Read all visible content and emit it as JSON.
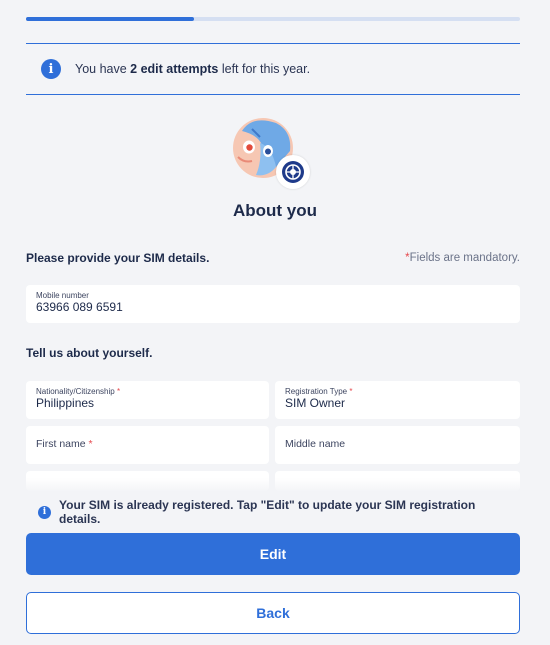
{
  "progress": {
    "fraction": 0.34
  },
  "notice": {
    "prefix": "You have ",
    "strong": "2 edit attempts",
    "suffix": " left for this year."
  },
  "page": {
    "title": "About you"
  },
  "sim_section": {
    "label": "Please provide your SIM details.",
    "mandatory_asterisk": "*",
    "mandatory_text": "Fields are mandatory."
  },
  "mobile": {
    "label": "Mobile number",
    "value": "63966 089 6591"
  },
  "about_section": {
    "label": "Tell us about yourself."
  },
  "fields": {
    "nationality": {
      "label": "Nationality/Citizenship",
      "required": "*",
      "value": "Philippines"
    },
    "registration_type": {
      "label": "Registration Type",
      "required": "*",
      "value": "SIM Owner"
    },
    "first_name": {
      "label": "First name",
      "required": "*"
    },
    "middle_name": {
      "label": "Middle name"
    }
  },
  "registered_notice": "Your SIM is already registered. Tap \"Edit\" to update your SIM registration details.",
  "buttons": {
    "edit": "Edit",
    "back": "Back"
  },
  "colors": {
    "accent": "#2f6fd9",
    "background": "#f3f4f7",
    "text": "#1d2a4a",
    "required": "#e5484d"
  }
}
